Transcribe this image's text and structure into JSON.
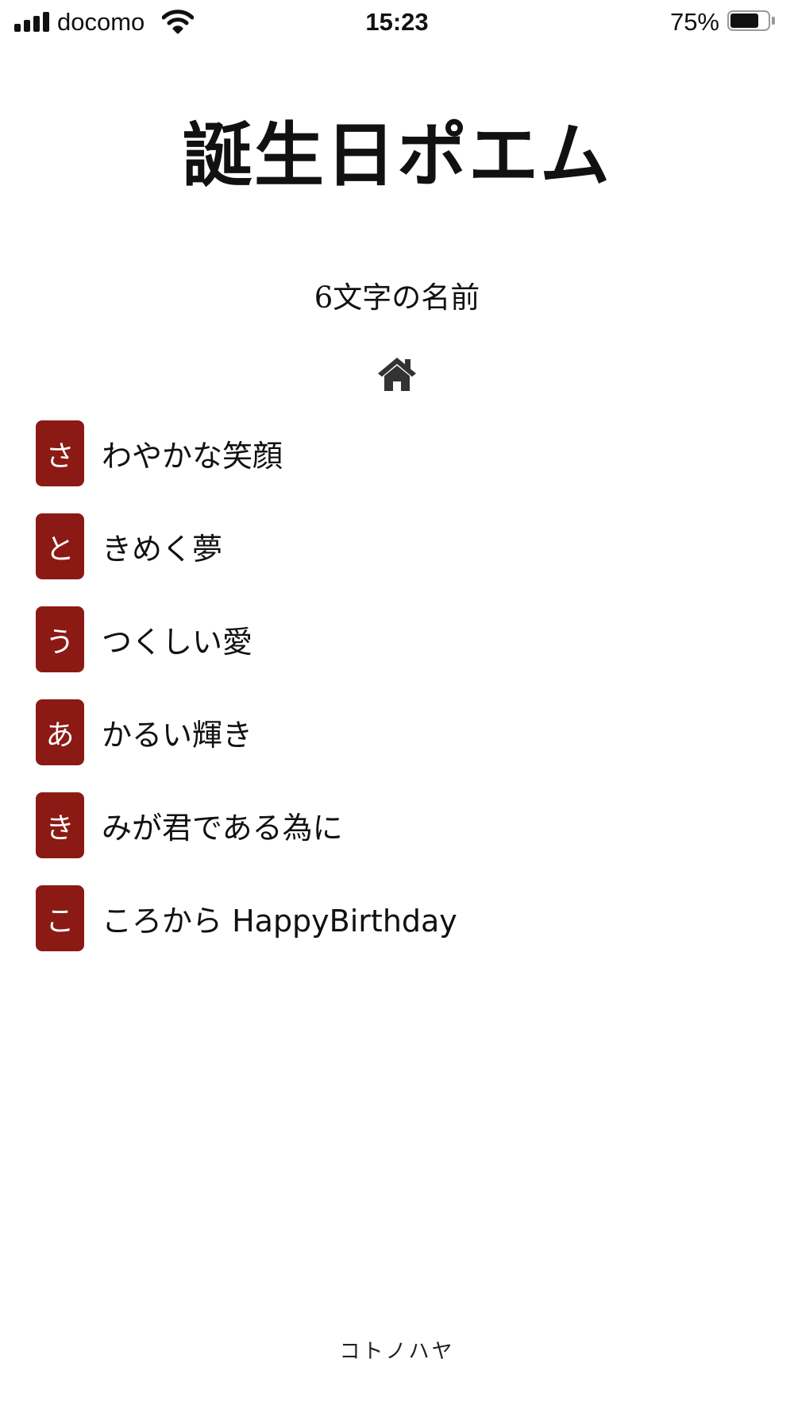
{
  "status_bar": {
    "carrier": "docomo",
    "time": "15:23",
    "battery_percent_label": "75%",
    "battery_level": 0.75,
    "signal_bars": 4
  },
  "page": {
    "title": "誕生日ポエム",
    "subtitle": "6文字の名前",
    "home_icon": "home-icon"
  },
  "poem": {
    "lines": [
      {
        "initial": "さ",
        "text": "わやかな笑顔"
      },
      {
        "initial": "と",
        "text": "きめく夢"
      },
      {
        "initial": "う",
        "text": "つくしい愛"
      },
      {
        "initial": "あ",
        "text": "かるい輝き"
      },
      {
        "initial": "き",
        "text": "みが君である為に"
      },
      {
        "initial": "こ",
        "text": "ころから HappyBirthday"
      }
    ]
  },
  "footer": {
    "brand": "コトノハヤ"
  },
  "colors": {
    "badge_background": "#8b1a14",
    "badge_text": "#ffffff",
    "text": "#111111",
    "background": "#ffffff"
  }
}
